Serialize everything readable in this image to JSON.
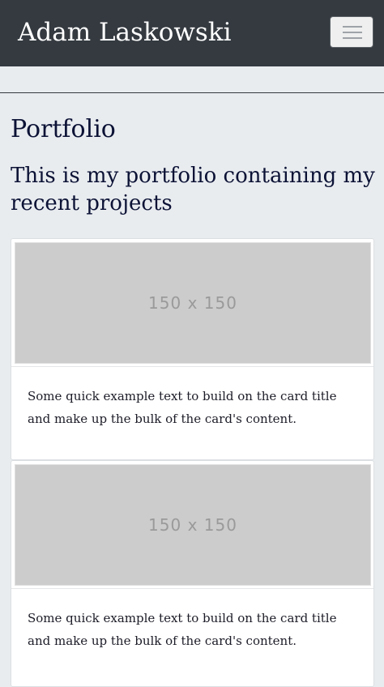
{
  "navbar": {
    "brand": "Adam Laskowski",
    "toggler_icon": "hamburger-menu-icon"
  },
  "main": {
    "title": "Portfolio",
    "subtitle": "This is my portfolio containing my recent projects",
    "cards": [
      {
        "image_label": "150 x 150",
        "text": "Some quick example text to build on the card title and make up the bulk of the card's content."
      },
      {
        "image_label": "150 x 150",
        "text": "Some quick example text to build on the card title and make up the bulk of the card's content."
      }
    ]
  },
  "colors": {
    "navbar_bg": "#343a40",
    "page_bg": "#e9ecef",
    "placeholder_bg": "#cccccc",
    "heading_text": "#0b1235"
  }
}
